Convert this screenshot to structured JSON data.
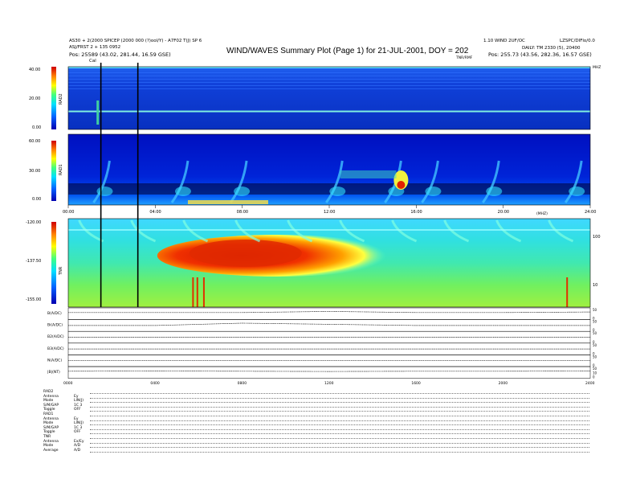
{
  "header": {
    "left_line1": "AS30 + 2(2000 SPICEP (2000 000 (?)ool/Y) - A7F02 T(J) SP 6",
    "left_line2": "ASJ/FRST 2 + 135 0952",
    "left_pos": "Pos:   25589 (43.02, 281.44, 16.59 GSE)",
    "right_line1": "1.10 WIND 2UF/OC",
    "right_line2": "LZSPC/DIFlo/0.0",
    "right_line3": "DAILY: TM 2330 (5), 20400",
    "right_pos": "Pos:   255.73 (43.56, 282.36, 16.57 GSE)",
    "marker_cal": "Cal",
    "marker_tnr_top": "TNR/RMF"
  },
  "title": "WIND/WAVES Summary Plot (Page 1) for 21-JUL-2001, DOY = 202",
  "panels": {
    "rad2": {
      "label": "RAD2",
      "ticks": [
        "40.00",
        "20.00",
        "0.00"
      ],
      "ylim": [
        0,
        40
      ]
    },
    "rad1": {
      "label": "RAD1",
      "ticks": [
        "60.00",
        "30.00",
        "0.00"
      ],
      "ylim": [
        0,
        60
      ]
    },
    "tnr": {
      "label": "TNR",
      "ticks": [
        "-120.00",
        "-137.50",
        "-155.00"
      ],
      "ylim": [
        -155,
        -120
      ],
      "right_ticks": [
        "100",
        "10"
      ],
      "top_right_label": "(MHZ)"
    },
    "mhz_label": "MHZ"
  },
  "time_axis": {
    "labels": [
      "00:00",
      "04:00",
      "08:00",
      "12:00",
      "16:00",
      "20:00",
      "24:00"
    ],
    "small_labels": [
      "0000",
      "0400",
      "0800",
      "1200",
      "1600",
      "2000",
      "2400"
    ]
  },
  "line_panels": [
    {
      "label": "B(A/DC)",
      "right_ticks": [
        "50",
        "0"
      ]
    },
    {
      "label": "Bi(A/DC)",
      "right_ticks": [
        "50",
        "0"
      ]
    },
    {
      "label": "B2(A/DC)",
      "right_ticks": [
        "50",
        "0"
      ]
    },
    {
      "label": "B3(A/DC)",
      "right_ticks": [
        "50",
        "0"
      ]
    },
    {
      "label": "N(A/DC)",
      "right_ticks": [
        "50",
        "0"
      ]
    },
    {
      "label": "|B|(NT)",
      "right_ticks": [
        "50",
        "10",
        "0"
      ]
    }
  ],
  "footer": [
    {
      "label": "RAD2",
      "value": ""
    },
    {
      "label": "Antenna",
      "value": "Ey"
    },
    {
      "label": "Mode",
      "value": "LIN(J)"
    },
    {
      "label": "S/M/GAP",
      "value": "1C 3"
    },
    {
      "label": "Toggle",
      "value": "OFF"
    },
    {
      "label": "RAD1",
      "value": ""
    },
    {
      "label": "Antenna",
      "value": "Ey"
    },
    {
      "label": "Mode",
      "value": "LIN(J)"
    },
    {
      "label": "S/M/GAP",
      "value": "1C 3"
    },
    {
      "label": "Toggle",
      "value": "OFF"
    },
    {
      "label": "TNR",
      "value": ""
    },
    {
      "label": "Antenna",
      "value": "Ex/Ey"
    },
    {
      "label": "Mode",
      "value": "A/D"
    },
    {
      "label": "Average",
      "value": "A/D"
    }
  ],
  "chart_data": [
    {
      "type": "heatmap",
      "name": "RAD2",
      "x_range": [
        "00:00",
        "24:00"
      ],
      "ylim": [
        0,
        40
      ],
      "vertical_markers_hours": [
        1.5,
        3.2
      ],
      "features": [
        {
          "x_hours": [
            0,
            24
          ],
          "y": 39.5,
          "intensity": "high",
          "kind": "band"
        },
        {
          "x_hours": [
            0,
            24
          ],
          "y": 11.5,
          "intensity": "high",
          "kind": "band"
        }
      ]
    },
    {
      "type": "heatmap",
      "name": "RAD1",
      "x_range": [
        "00:00",
        "24:00"
      ],
      "ylim": [
        0,
        60
      ],
      "bursts_hours": [
        1.9,
        5.5,
        8.2,
        12.6,
        15.3,
        17.0,
        19.8,
        23.6
      ],
      "intense_bursts": [
        {
          "x_hours": 15.3,
          "y": 10
        }
      ]
    },
    {
      "type": "heatmap",
      "name": "TNR",
      "x_range": [
        "00:00",
        "24:00"
      ],
      "ylim": [
        -155,
        -120
      ],
      "intense_region_hours": [
        5.2,
        12.0
      ],
      "spikes_hours": [
        5.7,
        5.9,
        6.2,
        22.9
      ]
    },
    {
      "type": "line",
      "name": "field panels",
      "x_range": [
        "00:00",
        "24:00"
      ],
      "series": [
        {
          "name": "B(A/DC)",
          "values": [
            0.6,
            0.6,
            0.6,
            0.7,
            0.6,
            0.6,
            0.65
          ]
        },
        {
          "name": "Bi(A/DC)",
          "values": [
            0.5,
            0.5,
            0.7,
            0.6,
            0.5,
            0.5,
            0.5
          ]
        },
        {
          "name": "B2(A/DC)",
          "values": [
            0.5,
            0.5,
            0.5,
            0.5,
            0.5,
            0.5,
            0.5
          ]
        },
        {
          "name": "B3(A/DC)",
          "values": [
            0.5,
            0.5,
            0.5,
            0.5,
            0.5,
            0.5,
            0.5
          ]
        },
        {
          "name": "N(A/DC)",
          "values": [
            0.5,
            0.5,
            0.5,
            0.5,
            0.5,
            0.5,
            0.5
          ]
        },
        {
          "name": "|B|(NT)",
          "values": [
            0.6,
            0.62,
            0.6,
            0.58,
            0.6,
            0.6,
            0.62
          ]
        }
      ]
    }
  ]
}
